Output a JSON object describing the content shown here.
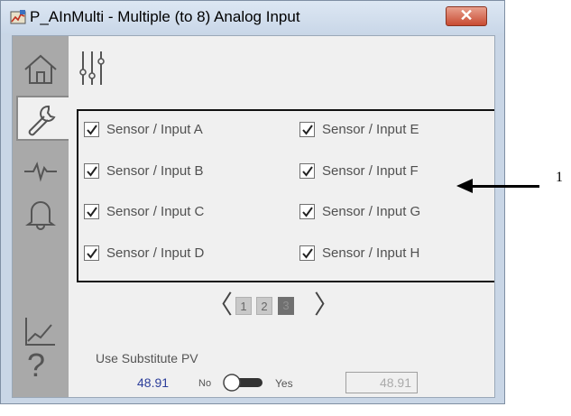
{
  "window": {
    "title": "P_AInMulti - Multiple (to 8) Analog Input"
  },
  "sidebar": {
    "items": [
      {
        "name": "home",
        "icon": "home-icon"
      },
      {
        "name": "maintenance",
        "icon": "wrench-icon",
        "active": true
      },
      {
        "name": "trends-waveform",
        "icon": "waveform-icon"
      },
      {
        "name": "alarms",
        "icon": "bell-icon"
      },
      {
        "name": "trend",
        "icon": "chart-line-icon"
      },
      {
        "name": "help",
        "icon": "help-icon",
        "label": "?"
      }
    ]
  },
  "main": {
    "toolbar_icon": "sliders-icon",
    "sensors": [
      {
        "label": "Sensor / Input A",
        "checked": true
      },
      {
        "label": "Sensor / Input B",
        "checked": true
      },
      {
        "label": "Sensor / Input C",
        "checked": true
      },
      {
        "label": "Sensor / Input D",
        "checked": true
      },
      {
        "label": "Sensor / Input E",
        "checked": true
      },
      {
        "label": "Sensor / Input F",
        "checked": true
      },
      {
        "label": "Sensor / Input G",
        "checked": true
      },
      {
        "label": "Sensor / Input H",
        "checked": true
      }
    ],
    "pager": {
      "prev": "〈",
      "next": "〉",
      "pages": [
        "1",
        "2",
        "3"
      ],
      "current_page": 3
    },
    "substitute": {
      "label": "Use Substitute PV",
      "pv_value": "48.91",
      "no_label": "No",
      "yes_label": "Yes",
      "input_value": "48.91"
    }
  },
  "callout": {
    "number": "1"
  },
  "colors": {
    "title_bar": "#c9d7e8",
    "close_button": "#c84b32",
    "sidebar": "#a9a9a9",
    "pv_value": "#2c3e9a"
  }
}
